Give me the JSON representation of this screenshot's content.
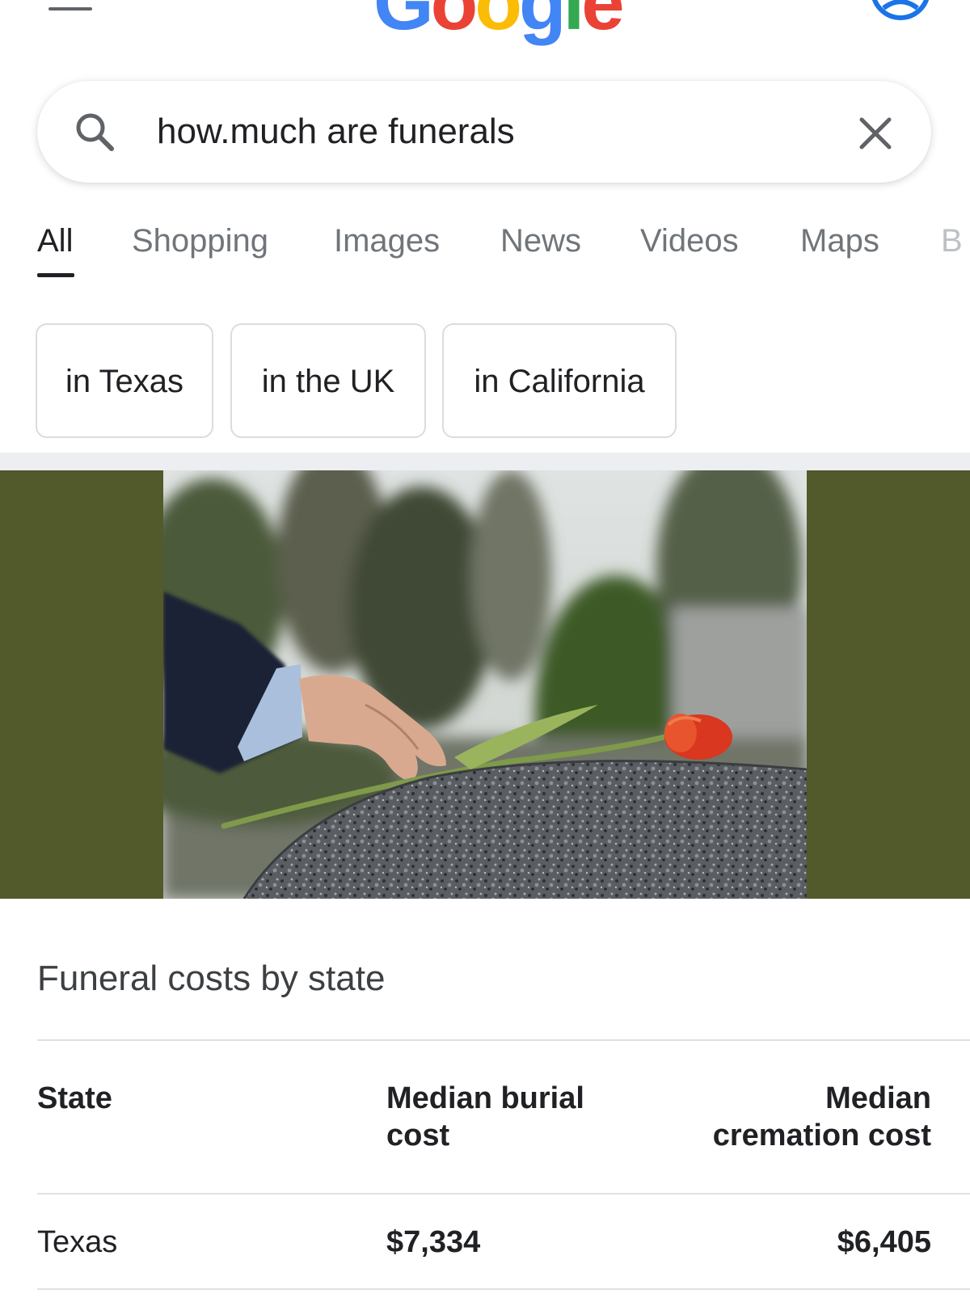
{
  "header": {
    "logo_text": "Google",
    "logo_colors": [
      "#4285f4",
      "#ea4335",
      "#fbbc05",
      "#4285f4",
      "#34a853",
      "#ea4335"
    ],
    "menu_icon": "hamburger-menu-icon",
    "account_icon": "account-circle-icon"
  },
  "search": {
    "query": "how.much are funerals",
    "search_icon": "search-icon",
    "clear_icon": "close-icon"
  },
  "tabs": [
    {
      "label": "All",
      "active": true
    },
    {
      "label": "Shopping",
      "active": false
    },
    {
      "label": "Images",
      "active": false
    },
    {
      "label": "News",
      "active": false
    },
    {
      "label": "Videos",
      "active": false
    },
    {
      "label": "Maps",
      "active": false
    },
    {
      "label": "B",
      "active": false
    }
  ],
  "chips": [
    {
      "label": "in Texas"
    },
    {
      "label": "in the UK"
    },
    {
      "label": "in California"
    }
  ],
  "featured_image": {
    "band_color": "#52592b"
  },
  "table": {
    "title": "Funeral costs by state",
    "headers": [
      "State",
      "Median burial cost",
      "Median cremation cost"
    ],
    "rows": [
      {
        "state": "Texas",
        "burial": "$7,334",
        "cremation": "$6,405"
      }
    ]
  }
}
